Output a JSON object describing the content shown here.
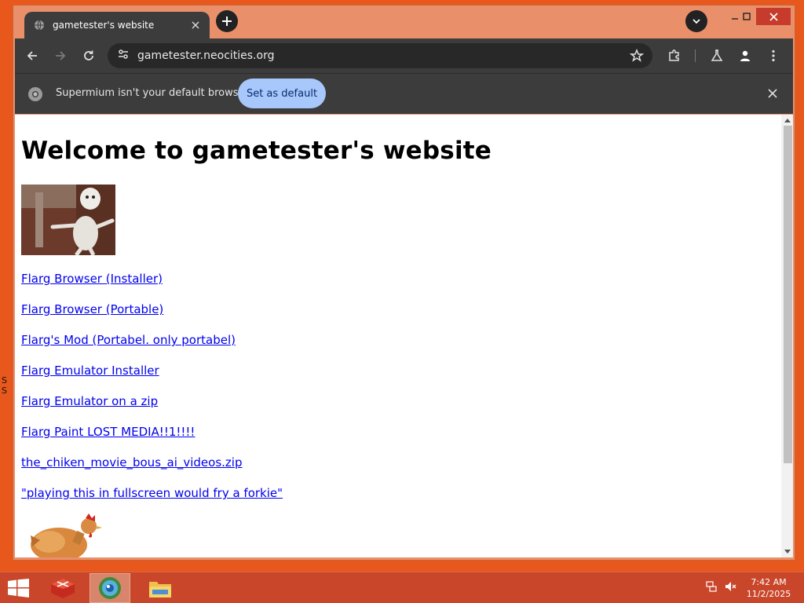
{
  "desktop": {
    "edge_marks": "S\nS"
  },
  "browser": {
    "tab_title": "gametester's website",
    "url": "gametester.neocities.org",
    "infobar_message": "Supermium isn't your default browser",
    "set_default_label": "Set as default"
  },
  "page": {
    "heading": "Welcome to gametester's website",
    "links": [
      "Flarg Browser (Installer)",
      "Flarg Browser (Portable)",
      "Flarg's Mod (Portabel. only portabel)",
      "Flarg Emulator Installer",
      "Flarg Emulator on a zip",
      "Flarg Paint LOST MEDIA!!1!!!!",
      "the_chiken_movie_bous_ai_videos.zip",
      "\"playing this in fullscreen would fry a forkie\""
    ]
  },
  "taskbar": {
    "time": "7:42 AM",
    "date": "11/2/2025"
  },
  "colors": {
    "desktop": "#e8571c",
    "taskbar": "#c9462a",
    "browser_frame": "#e9906a",
    "toolbar": "#3c3c3c",
    "link": "#0000ee",
    "set_default_button": "#a8c7fa"
  }
}
